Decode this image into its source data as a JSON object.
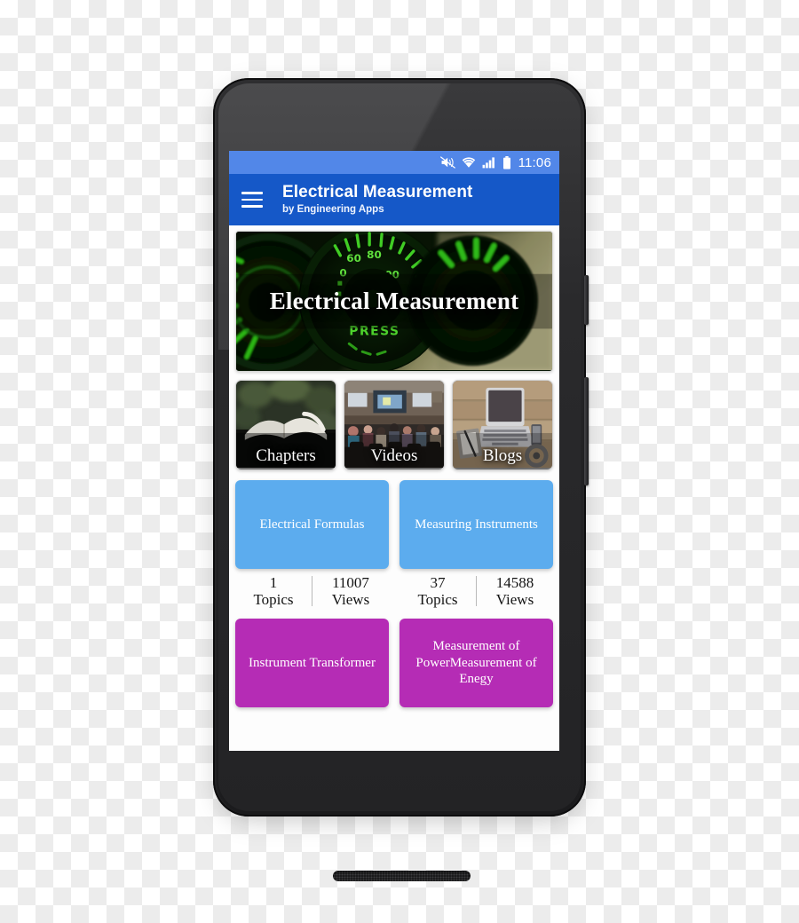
{
  "phone": {
    "hardware": {
      "front_camera": "front-camera",
      "earpiece_speaker": "earpiece-speaker-grille",
      "bottom_speaker": "bottom-speaker-grille",
      "power_button": "power-button",
      "volume_button": "volume-rocker-button"
    }
  },
  "status_bar": {
    "time": "11:06",
    "icons": [
      "mute-vibrate-icon",
      "wifi-icon",
      "cellular-signal-icon",
      "battery-icon"
    ],
    "background_color": "#5287e8"
  },
  "app_bar": {
    "menu_icon": "hamburger-menu-icon",
    "title": "Electrical Measurement",
    "subtitle": "by Engineering Apps",
    "background_color": "#1558c8"
  },
  "hero": {
    "title": "Electrical Measurement",
    "image_alt": "green illuminated car gauges",
    "gauge_labels": [
      "60",
      "80",
      "0",
      "100",
      "PRESS"
    ]
  },
  "category_cards": [
    {
      "label": "Chapters",
      "image_alt": "open book on dark background"
    },
    {
      "label": "Videos",
      "image_alt": "lecture hall audience with projector screens"
    },
    {
      "label": "Blogs",
      "image_alt": "laptop notebook and pen on wooden desk"
    }
  ],
  "topics": [
    {
      "title": "Electrical Formulas",
      "color": "#5cacee",
      "topics_count": "1",
      "topics_label": "Topics",
      "views_count": "11007",
      "views_label": "Views"
    },
    {
      "title": "Measuring Instruments",
      "color": "#5cacee",
      "topics_count": "37",
      "topics_label": "Topics",
      "views_count": "14588",
      "views_label": "Views"
    },
    {
      "title": "Instrument Transformer",
      "color": "#b52cb5",
      "topics_count": "",
      "topics_label": "",
      "views_count": "",
      "views_label": ""
    },
    {
      "title": "Measurement of PowerMeasurement of Enegy",
      "color": "#b52cb5",
      "topics_count": "",
      "topics_label": "",
      "views_count": "",
      "views_label": ""
    }
  ]
}
